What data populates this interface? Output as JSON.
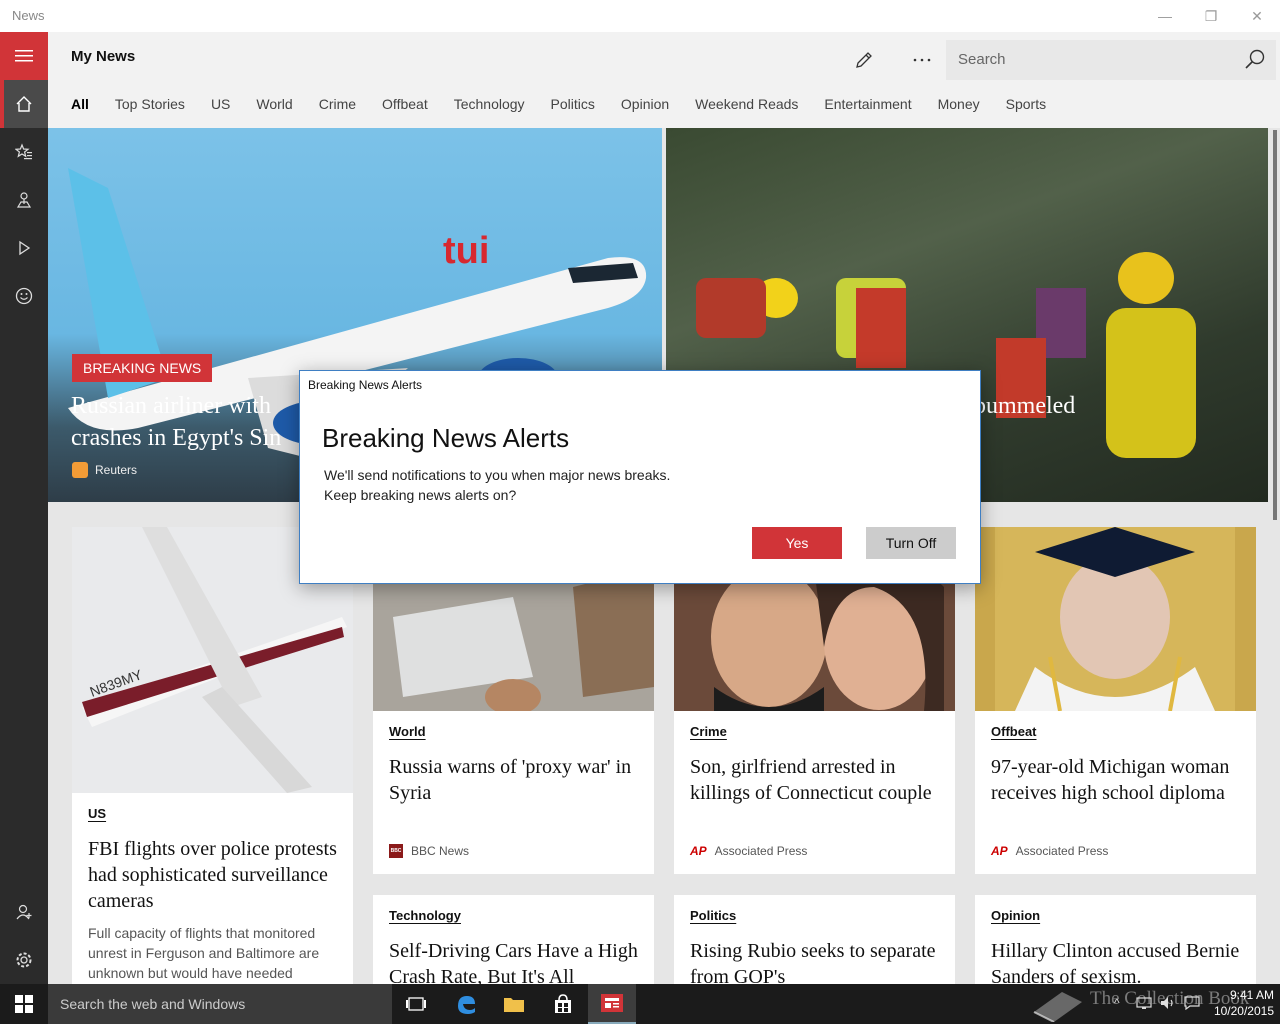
{
  "window": {
    "title": "News",
    "minimize": "—",
    "restore": "❐",
    "close": "✕"
  },
  "header": {
    "title": "My News",
    "search_placeholder": "Search",
    "tabs": [
      {
        "label": "All",
        "active": true
      },
      {
        "label": "Top Stories"
      },
      {
        "label": "US"
      },
      {
        "label": "World"
      },
      {
        "label": "Crime"
      },
      {
        "label": "Offbeat"
      },
      {
        "label": "Technology"
      },
      {
        "label": "Politics"
      },
      {
        "label": "Opinion"
      },
      {
        "label": "Weekend Reads"
      },
      {
        "label": "Entertainment"
      },
      {
        "label": "Money"
      },
      {
        "label": "Sports"
      }
    ]
  },
  "rail": {
    "items": [
      "hamburger-icon",
      "home-icon",
      "favorites-icon",
      "local-icon",
      "video-icon",
      "smiley-icon",
      "account-icon",
      "settings-icon"
    ]
  },
  "hero": {
    "badge": "BREAKING NEWS",
    "left_headline_line1": "Russian airliner with",
    "left_headline_line2": "crashes in Egypt's Sin",
    "left_source": "Reuters",
    "right_headline": "pummeled"
  },
  "cards": [
    {
      "category": "US",
      "headline": "FBI flights over police protests had sophisticated surveillance cameras",
      "summary": "Full capacity of flights that monitored unrest in Ferguson and Baltimore are unknown but would have needed"
    },
    {
      "category": "World",
      "headline": "Russia warns of 'proxy war' in Syria",
      "source": "BBC News",
      "logo": "BBC"
    },
    {
      "category": "Crime",
      "headline": "Son, girlfriend arrested in killings of Connecticut couple",
      "source": "Associated Press",
      "logo": "AP"
    },
    {
      "category": "Offbeat",
      "headline": "97-year-old Michigan woman receives high school diploma",
      "source": "Associated Press",
      "logo": "AP"
    },
    {
      "category": "Technology",
      "headline": "Self-Driving Cars Have a High Crash Rate, But It's All"
    },
    {
      "category": "Politics",
      "headline": "Rising Rubio seeks to separate from GOP's"
    },
    {
      "category": "Opinion",
      "headline": "Hillary Clinton accused Bernie Sanders of sexism."
    }
  ],
  "dialog": {
    "caption": "Breaking News Alerts",
    "title": "Breaking News Alerts",
    "body_line1": "We'll send notifications to you when major news breaks.",
    "body_line2": "Keep breaking news alerts on?",
    "yes_label": "Yes",
    "off_label": "Turn Off"
  },
  "taskbar": {
    "search_placeholder": "Search the web and Windows",
    "time": "9:41 AM",
    "date": "10/20/2015",
    "watermark": "The Collection Book"
  },
  "colors": {
    "accent": "#d13438",
    "rail": "#2b2b2b",
    "dialog_border": "#3f7fc3"
  }
}
